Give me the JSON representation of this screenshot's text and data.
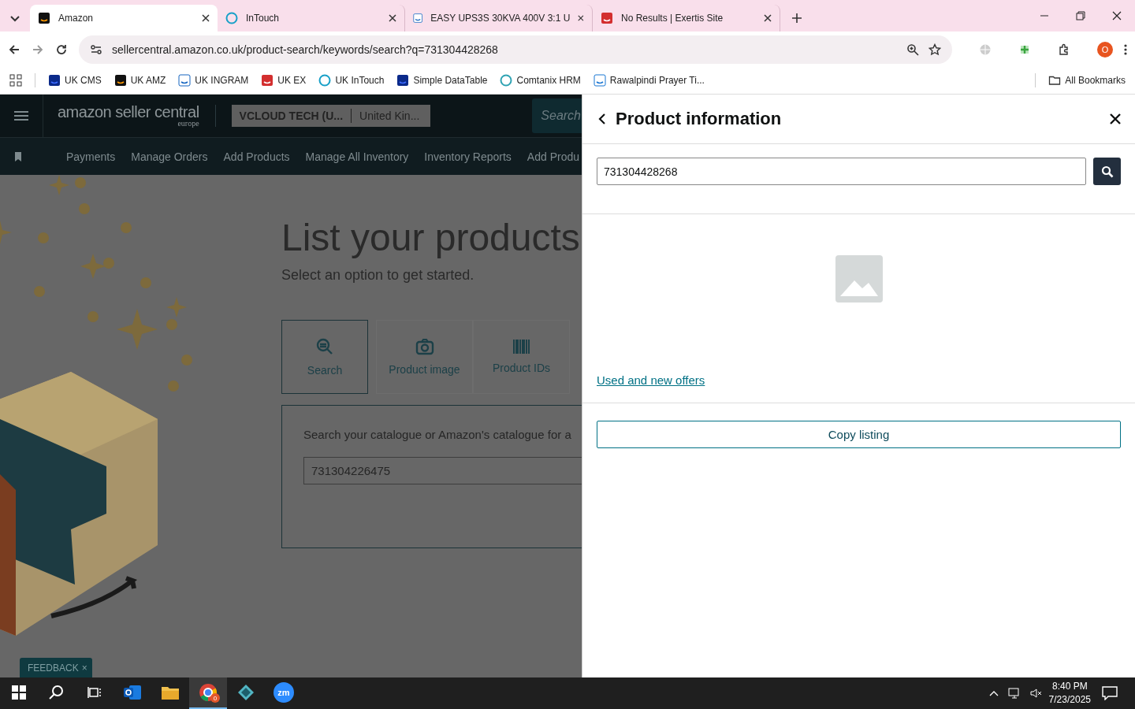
{
  "browser": {
    "tabs": [
      {
        "title": "Amazon",
        "kind": "amazon",
        "selected": true
      },
      {
        "title": "InTouch",
        "kind": "intouch",
        "selected": false
      },
      {
        "title": "EASY UPS3S 30KVA 400V 3:1 U",
        "kind": "ups",
        "selected": false
      },
      {
        "title": "No Results | Exertis Site",
        "kind": "exertis",
        "selected": false
      }
    ],
    "address": "sellercentral.amazon.co.uk/product-search/keywords/search?q=731304428268",
    "profile": "O",
    "bookmarks": [
      {
        "label": "UK CMS",
        "kind": "df"
      },
      {
        "label": "UK AMZ",
        "kind": "amazon"
      },
      {
        "label": "UK INGRAM",
        "kind": "ups"
      },
      {
        "label": "UK EX",
        "kind": "exertis"
      },
      {
        "label": "UK InTouch",
        "kind": "intouch"
      },
      {
        "label": "Simple DataTable",
        "kind": "df"
      },
      {
        "label": "Comtanix HRM",
        "kind": "comtanix"
      },
      {
        "label": "Rawalpindi Prayer Ti...",
        "kind": "prayer"
      }
    ],
    "all_bookmarks": "All Bookmarks"
  },
  "page": {
    "logo": "amazon seller central",
    "logo_region": "europe",
    "account": "VCLOUD TECH (U...",
    "marketplace": "United Kin...",
    "search_placeholder": "Search",
    "nav": [
      "Payments",
      "Manage Orders",
      "Add Products",
      "Manage All Inventory",
      "Inventory Reports",
      "Add Produ"
    ],
    "heading": "List your products",
    "subtitle": "Select an option to get started.",
    "options": [
      {
        "label": "Search",
        "kind": "search",
        "selected": true
      },
      {
        "label": "Product image",
        "kind": "camera",
        "selected": false
      },
      {
        "label": "Product IDs",
        "kind": "barcode",
        "selected": false
      }
    ],
    "prompt": "Search your catalogue or Amazon's catalogue for a",
    "query": "731304226475",
    "feedback": "FEEDBACK",
    "feedback_close": "×"
  },
  "drawer": {
    "title": "Product information",
    "query": "731304428268",
    "link": "Used and new offers",
    "button": "Copy listing"
  },
  "taskbar": {
    "chrome_badge": "0",
    "zoom_label": "zm",
    "time": "8:40 PM",
    "date": "7/23/2025"
  }
}
